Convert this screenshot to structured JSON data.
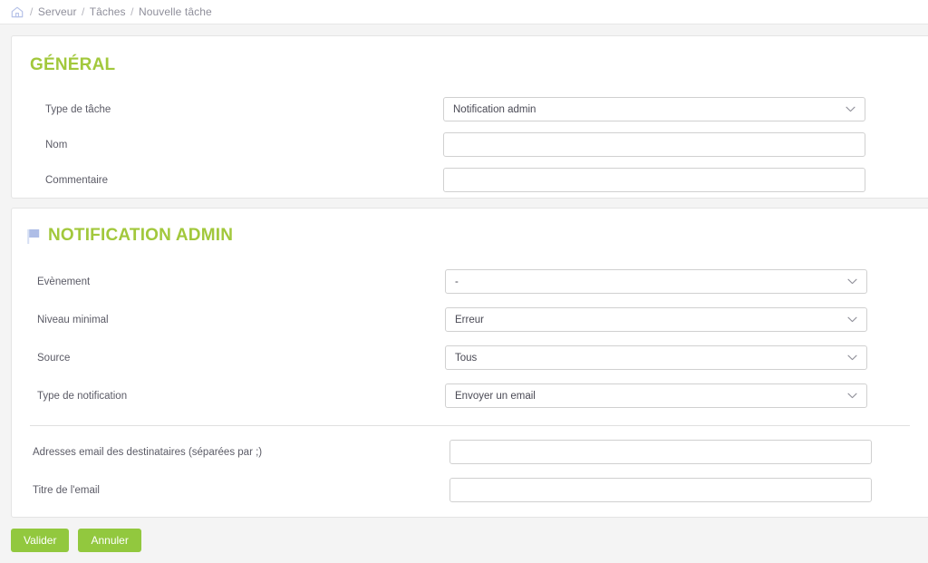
{
  "breadcrumb": {
    "home_icon": "home-icon",
    "items": [
      "Serveur",
      "Tâches",
      "Nouvelle tâche"
    ],
    "separator": "/"
  },
  "sections": [
    {
      "id": "general",
      "title": "GÉNÉRAL",
      "icon": null,
      "fields": [
        {
          "label": "Type de tâche",
          "type": "select",
          "value": "Notification admin"
        },
        {
          "label": "Nom",
          "type": "text",
          "value": "",
          "placeholder": ""
        },
        {
          "label": "Commentaire",
          "type": "text",
          "value": "",
          "placeholder": ""
        }
      ]
    },
    {
      "id": "notification-admin",
      "title": "NOTIFICATION ADMIN",
      "icon": "flag-icon",
      "fields": [
        {
          "label": "Evènement",
          "type": "select",
          "value": "-"
        },
        {
          "label": "Niveau minimal",
          "type": "select",
          "value": "Erreur"
        },
        {
          "label": "Source",
          "type": "select",
          "value": "Tous"
        },
        {
          "label": "Type de notification",
          "type": "select",
          "value": "Envoyer un email"
        }
      ],
      "fields_after_divider": [
        {
          "label": "Adresses email des destinataires (séparées par ;)",
          "type": "text",
          "value": "",
          "placeholder": ""
        },
        {
          "label": "Titre de l'email",
          "type": "text",
          "value": "",
          "placeholder": ""
        }
      ]
    }
  ],
  "footer": {
    "submit_label": "Valider",
    "cancel_label": "Annuler"
  },
  "colors": {
    "accent_green": "#a2c83c",
    "button_green": "#92c83e",
    "page_background": "#f4f4f4",
    "panel_background": "#ffffff",
    "label_text": "#5b5b66",
    "breadcrumb_text": "#9a9aa5",
    "flag_blue": "#aebde6"
  }
}
